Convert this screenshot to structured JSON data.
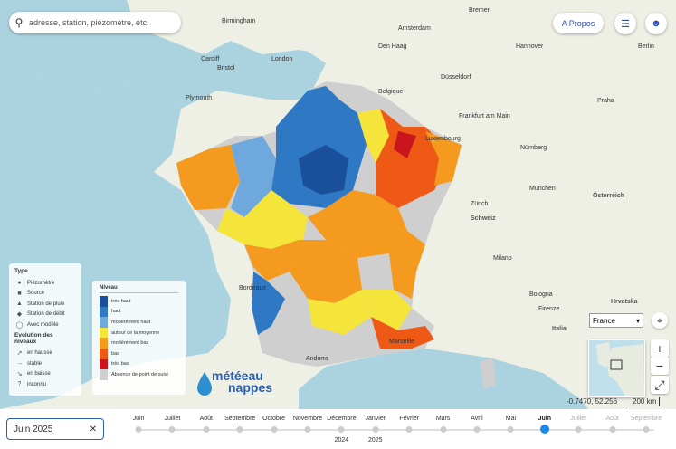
{
  "search": {
    "placeholder": "adresse, station, piézomètre, etc."
  },
  "header": {
    "apropos_label": "A Propos",
    "layers_icon": "layers-icon",
    "user_icon": "user-icon"
  },
  "legend_type": {
    "title": "Type",
    "items": [
      {
        "symbol": "●",
        "label": "Piézomètre"
      },
      {
        "symbol": "■",
        "label": "Source"
      },
      {
        "symbol": "▲",
        "label": "Station de pluie"
      },
      {
        "symbol": "◆",
        "label": "Station de débit"
      },
      {
        "symbol": "◯",
        "label": "Avec modèle"
      }
    ],
    "evolution_title": "Evolution des niveaux",
    "evolution": [
      {
        "symbol": "↗",
        "label": "en hausse"
      },
      {
        "symbol": "→",
        "label": "stable"
      },
      {
        "symbol": "↘",
        "label": "en baisse"
      },
      {
        "symbol": "?",
        "label": "inconnu"
      }
    ]
  },
  "legend_niveau": {
    "title": "Niveau",
    "items": [
      {
        "color": "#1a4f9c",
        "label": "très haut"
      },
      {
        "color": "#2f78c4",
        "label": "haut"
      },
      {
        "color": "#6fa8dc",
        "label": "modérément haut"
      },
      {
        "color": "#f5e43a",
        "label": "autour de la moyenne"
      },
      {
        "color": "#f39a1f",
        "label": "modérément bas"
      },
      {
        "color": "#ee5a16",
        "label": "bas"
      },
      {
        "color": "#c8161c",
        "label": "très bas"
      },
      {
        "color": "#cfcfcf",
        "label": "Absence de point de suivi"
      }
    ]
  },
  "logo": {
    "line1": "météeau",
    "line2": "nappes"
  },
  "map_labels": [
    {
      "text": "Birmingham"
    },
    {
      "text": "London"
    },
    {
      "text": "Cardiff"
    },
    {
      "text": "Bristol"
    },
    {
      "text": "Plymouth"
    },
    {
      "text": "Den Haag"
    },
    {
      "text": "Amsterdam"
    },
    {
      "text": "Bremen"
    },
    {
      "text": "Hannover"
    },
    {
      "text": "Berlin"
    },
    {
      "text": "Düsseldorf"
    },
    {
      "text": "Frankfurt am Main"
    },
    {
      "text": "Praha"
    },
    {
      "text": "Nürnberg"
    },
    {
      "text": "München"
    },
    {
      "text": "Österreich"
    },
    {
      "text": "Zürich"
    },
    {
      "text": "Schweiz"
    },
    {
      "text": "Milano"
    },
    {
      "text": "Bologna"
    },
    {
      "text": "Hrvatska"
    },
    {
      "text": "Bordeaux"
    },
    {
      "text": "Marseille"
    },
    {
      "text": "Andorra"
    },
    {
      "text": "Luxembourg"
    },
    {
      "text": "Belgique"
    },
    {
      "text": "Italia"
    },
    {
      "text": "Firenze"
    }
  ],
  "country_select": {
    "value": "France"
  },
  "zoom": {
    "in": "+",
    "out": "−",
    "fullscreen": "⤢"
  },
  "coords": "-0.7470, 52.256",
  "scale": "200 km",
  "date_input": {
    "value": "Juin 2025"
  },
  "timeline": {
    "months": [
      "Juin",
      "Juillet",
      "Août",
      "Septembre",
      "Octobre",
      "Novembre",
      "Décembre",
      "Janvier",
      "Février",
      "Mars",
      "Avril",
      "Mai",
      "Juin",
      "Juillet",
      "Août",
      "Septembre"
    ],
    "current_index": 12,
    "years": [
      {
        "label": "2024",
        "month_index": 6
      },
      {
        "label": "2025",
        "month_index": 7
      }
    ]
  }
}
